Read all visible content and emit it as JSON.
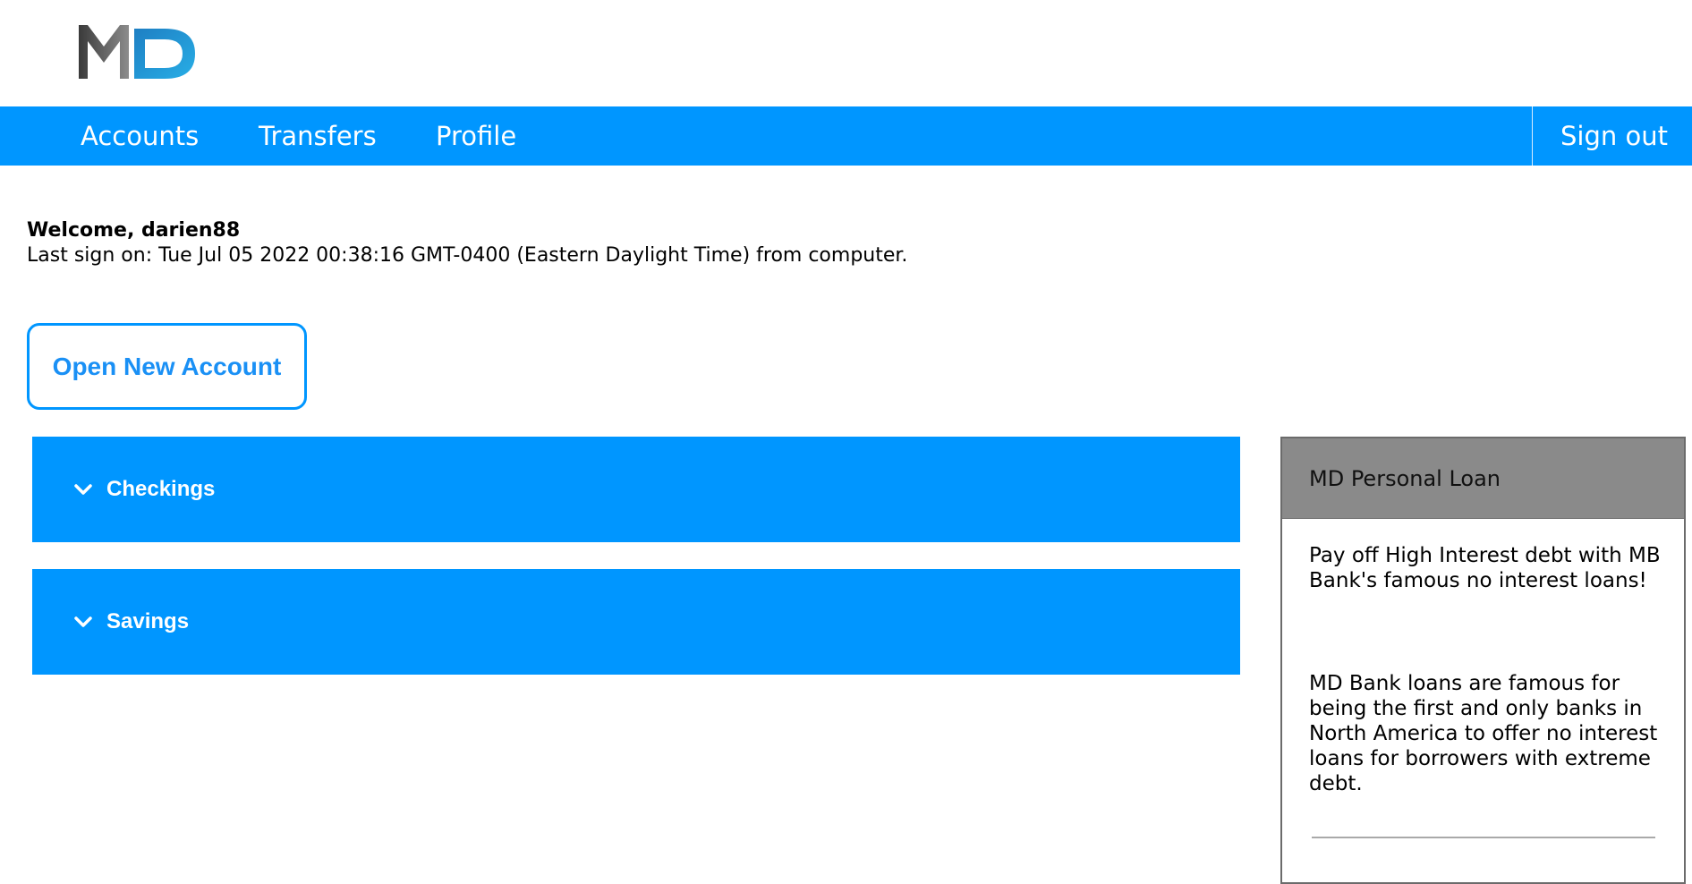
{
  "brand": {
    "logo_text": "MD"
  },
  "nav": {
    "items": [
      {
        "label": "Accounts"
      },
      {
        "label": "Transfers"
      },
      {
        "label": "Profile"
      }
    ],
    "sign_out": "Sign out"
  },
  "welcome": {
    "greeting": "Welcome, darien88",
    "last_sign_on": "Last sign on: Tue Jul 05 2022 00:38:16 GMT-0400 (Eastern Daylight Time) from computer."
  },
  "actions": {
    "open_account": "Open New Account"
  },
  "accounts": {
    "sections": [
      {
        "label": "Checkings",
        "icon": "chevron-down-icon"
      },
      {
        "label": "Savings",
        "icon": "chevron-down-icon"
      }
    ]
  },
  "promo": {
    "title": "MD Personal Loan",
    "paragraph1": "Pay off High Interest debt with MB Bank's famous no interest loans!",
    "paragraph2": "MD Bank loans are famous for being the first and only banks in North America to offer no interest loans for borrowers with extreme debt."
  },
  "colors": {
    "accent": "#0096ff",
    "promo_header": "#8a8a8a"
  }
}
